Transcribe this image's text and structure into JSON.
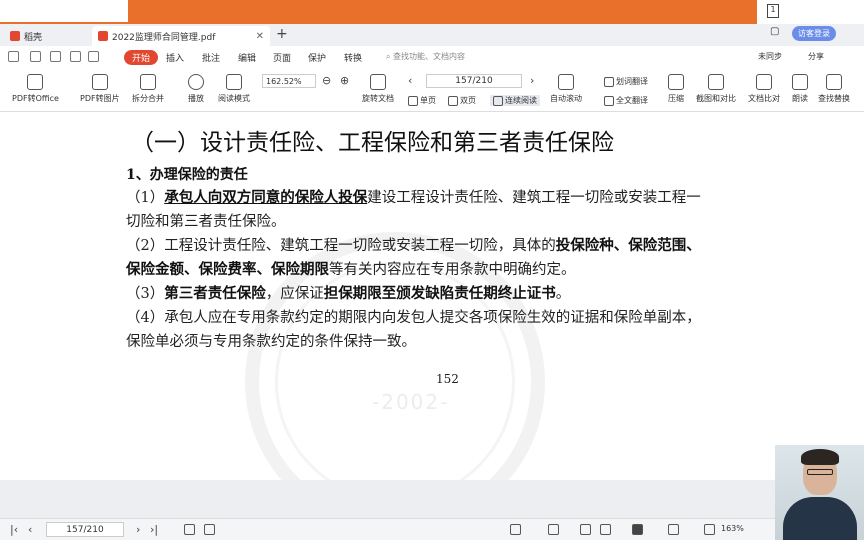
{
  "app": {
    "tabs": [
      {
        "label": "稻壳"
      },
      {
        "label": "2022监理师合同管理.pdf"
      }
    ],
    "visitor_login": "访客登录",
    "page_indicator_top": "1"
  },
  "menu": {
    "items": [
      "开始",
      "插入",
      "批注",
      "编辑",
      "页面",
      "保护",
      "转换"
    ],
    "search_placeholder": "查找功能、文档内容",
    "right_items": [
      "未同步",
      "分享"
    ]
  },
  "toolbar": {
    "tools": [
      {
        "label": "PDF转Office",
        "icon": "pdf-to-office-icon"
      },
      {
        "label": "PDF转图片",
        "icon": "pdf-to-image-icon"
      },
      {
        "label": "拆分合并",
        "icon": "split-merge-icon"
      },
      {
        "label": "播放",
        "icon": "play-icon"
      },
      {
        "label": "阅读模式",
        "icon": "read-mode-icon"
      },
      {
        "label": "旋转文档",
        "icon": "rotate-doc-icon"
      },
      {
        "label": "自动滚动",
        "icon": "auto-scroll-icon"
      },
      {
        "label": "压缩",
        "icon": "compress-icon"
      },
      {
        "label": "截图和对比",
        "icon": "screenshot-compare-icon"
      },
      {
        "label": "文档比对",
        "icon": "doc-compare-icon"
      },
      {
        "label": "朗读",
        "icon": "read-aloud-icon"
      },
      {
        "label": "查找替换",
        "icon": "find-replace-icon"
      }
    ],
    "zoom": "162.52%",
    "page": "157/210",
    "single_page": "单页",
    "double_page": "双页",
    "continuous": "连续阅读",
    "translate_word": "划词翻译",
    "translate_full": "全文翻译"
  },
  "document": {
    "heading": "（一）设计责任险、工程保险和第三者责任保险",
    "subheading": "1、办理保险的责任",
    "para1_prefix": "（1）",
    "para1_bold": "承包人向双方同意的保险人投保",
    "para1_rest": "建设工程设计责任险、建筑工程一切险或安装工程一",
    "para1_line2": "切险和第三者责任保险。",
    "para2_prefix": "（2）工程设计责任险、建筑工程一切险或安装工程一切险，具体的",
    "para2_bold1": "投保险种、保险范围、",
    "para2_bold2": "保险金额、保险费率、保险期限",
    "para2_rest": "等有关内容应在专用条款中明确约定。",
    "para3_prefix": "（3）",
    "para3_bold1": "第三者责任保险",
    "para3_mid": "，应保证",
    "para3_bold2": "担保期限至颁发缺陷责任期终止证书",
    "para3_end": "。",
    "para4_line1": "（4）承包人应在专用条款约定的期限内向发包人提交各项保险生效的证据和保险单副本，",
    "para4_line2": "保险单必须与专用条款约定的条件保持一致。",
    "page_number": "152",
    "watermark_year": "-2002-"
  },
  "statusbar": {
    "page": "157/210",
    "zoom": "163%"
  }
}
